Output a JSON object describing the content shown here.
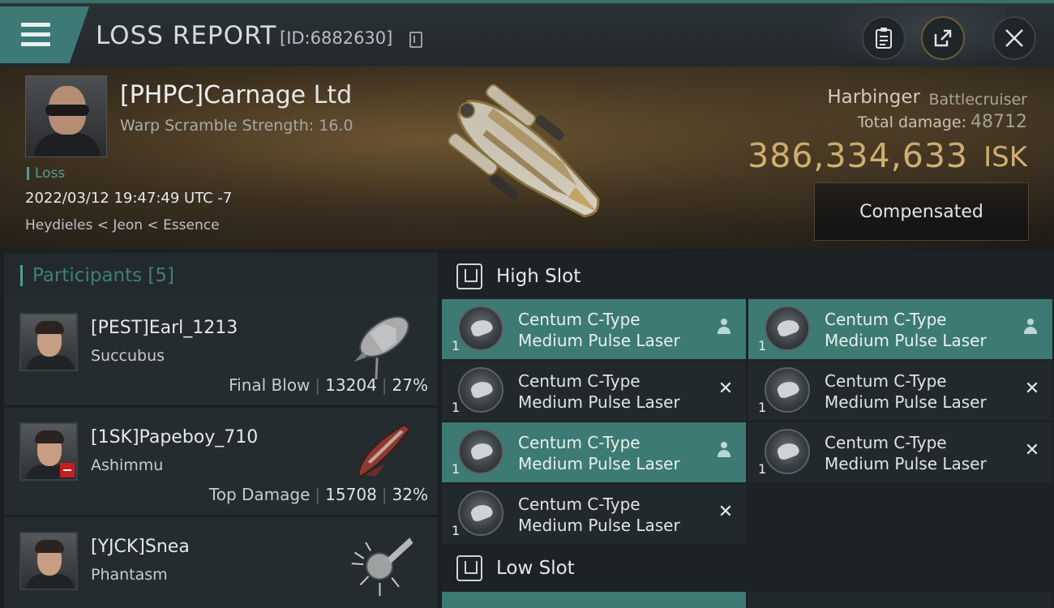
{
  "header": {
    "title": "LOSS REPORT",
    "report_id": "[ID:6882630]"
  },
  "victim": {
    "name": "[PHPC]Carnage Ltd",
    "warp_scramble": "Warp Scramble Strength: 16.0",
    "loss_label": "Loss",
    "timestamp": "2022/03/12 19:47:49 UTC -7",
    "location": "Heydieles < Jeon < Essence",
    "ship_name": "Harbinger",
    "ship_class": "Battlecruiser",
    "total_damage_label": "Total damage:",
    "total_damage_value": "48712",
    "isk_value": "386,334,633",
    "isk_unit": "ISK",
    "compensation_label": "Compensated"
  },
  "participants": {
    "header": "Participants [5]",
    "rows": [
      {
        "name": "[PEST]Earl_1213",
        "ship": "Succubus",
        "label": "Final Blow",
        "damage": "13204",
        "percent": "27%"
      },
      {
        "name": "[1SK]Papeboy_710",
        "ship": "Ashimmu",
        "label": "Top Damage",
        "damage": "15708",
        "percent": "32%"
      },
      {
        "name": "[YJCK]Snea",
        "ship": "Phantasm",
        "label": "",
        "damage": "",
        "percent": ""
      }
    ]
  },
  "fitting": {
    "high_slot_title": "High Slot",
    "low_slot_title": "Low Slot",
    "high_modules": [
      {
        "line1": "Centum C-Type",
        "line2": "Medium Pulse Laser",
        "qty": "1",
        "status": "fitted"
      },
      {
        "line1": "Centum C-Type",
        "line2": "Medium Pulse Laser",
        "qty": "1",
        "status": "fitted"
      },
      {
        "line1": "Centum C-Type",
        "line2": "Medium Pulse Laser",
        "qty": "1",
        "status": "destroyed"
      },
      {
        "line1": "Centum C-Type",
        "line2": "Medium Pulse Laser",
        "qty": "1",
        "status": "destroyed"
      },
      {
        "line1": "Centum C-Type",
        "line2": "Medium Pulse Laser",
        "qty": "1",
        "status": "fitted"
      },
      {
        "line1": "Centum C-Type",
        "line2": "Medium Pulse Laser",
        "qty": "1",
        "status": "destroyed"
      },
      {
        "line1": "Centum C-Type",
        "line2": "Medium Pulse Laser",
        "qty": "1",
        "status": "destroyed"
      }
    ]
  },
  "icons": {
    "menu": "hamburger-menu-icon",
    "copy": "copy-icon",
    "clipboard": "clipboard-icon",
    "share": "share-icon",
    "close": "close-icon",
    "slot": "slot-icon",
    "fitted_marker": "person-icon",
    "destroyed_marker": "x-icon"
  },
  "colors": {
    "accent_teal": "#3d7a74",
    "isk_gold": "#e8c681",
    "loss_green": "#4f9e95"
  }
}
